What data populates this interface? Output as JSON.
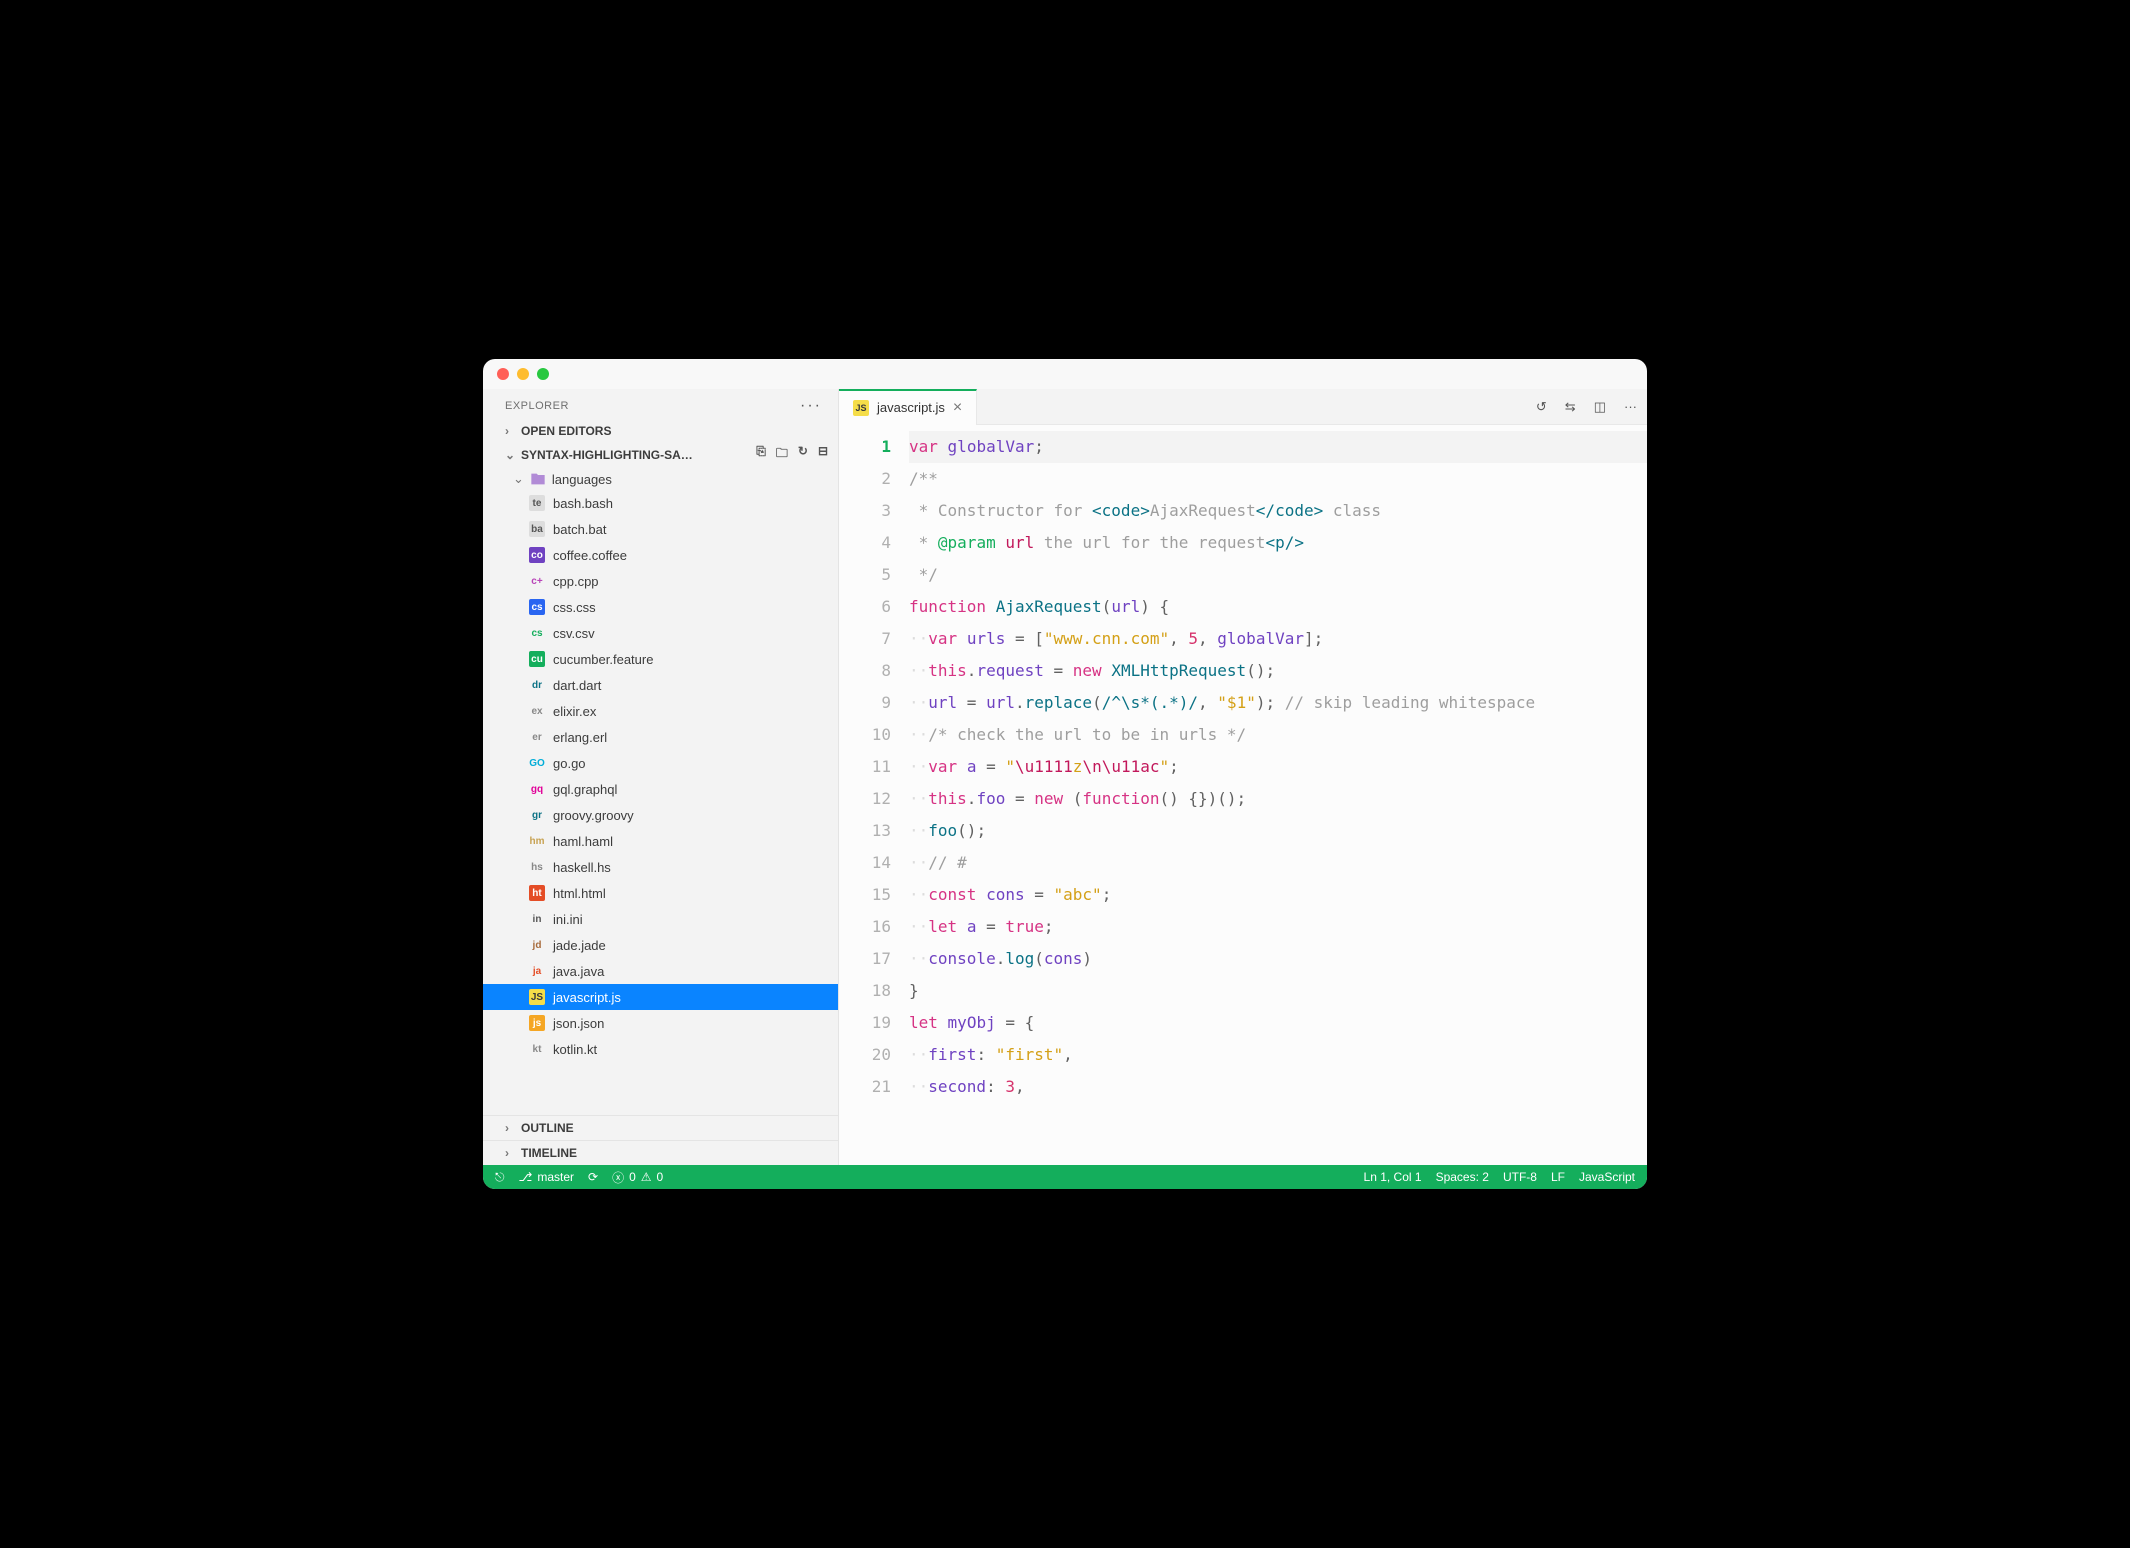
{
  "sidebar": {
    "title": "EXPLORER",
    "open_editors": "OPEN EDITORS",
    "project_name": "SYNTAX-HIGHLIGHTING-SA…",
    "folder": "languages",
    "files": [
      {
        "name": "bash.bash",
        "icon": "term",
        "color": "#555",
        "bg": "#ddd"
      },
      {
        "name": "batch.bat",
        "icon": "bat",
        "color": "#555",
        "bg": "#ddd"
      },
      {
        "name": "coffee.coffee",
        "icon": "cof",
        "color": "#fff",
        "bg": "#6f42c1"
      },
      {
        "name": "cpp.cpp",
        "icon": "c++",
        "color": "#b842b8",
        "bg": "transparent"
      },
      {
        "name": "css.css",
        "icon": "css",
        "color": "#fff",
        "bg": "#2965f1"
      },
      {
        "name": "csv.csv",
        "icon": "csv",
        "color": "#14ae5c",
        "bg": "transparent"
      },
      {
        "name": "cucumber.feature",
        "icon": "cuc",
        "color": "#fff",
        "bg": "#14ae5c"
      },
      {
        "name": "dart.dart",
        "icon": "drt",
        "color": "#0b7285",
        "bg": "transparent"
      },
      {
        "name": "elixir.ex",
        "icon": "ex",
        "color": "#888",
        "bg": "transparent"
      },
      {
        "name": "erlang.erl",
        "icon": "erl",
        "color": "#888",
        "bg": "transparent"
      },
      {
        "name": "go.go",
        "icon": "GO",
        "color": "#00add8",
        "bg": "transparent"
      },
      {
        "name": "gql.graphql",
        "icon": "gql",
        "color": "#e10098",
        "bg": "transparent"
      },
      {
        "name": "groovy.groovy",
        "icon": "grv",
        "color": "#0b7285",
        "bg": "transparent"
      },
      {
        "name": "haml.haml",
        "icon": "hml",
        "color": "#c7a252",
        "bg": "transparent"
      },
      {
        "name": "haskell.hs",
        "icon": "hs",
        "color": "#888",
        "bg": "transparent"
      },
      {
        "name": "html.html",
        "icon": "htm",
        "color": "#fff",
        "bg": "#e44d26"
      },
      {
        "name": "ini.ini",
        "icon": "ini",
        "color": "#555",
        "bg": "transparent"
      },
      {
        "name": "jade.jade",
        "icon": "jde",
        "color": "#a86b3c",
        "bg": "transparent"
      },
      {
        "name": "java.java",
        "icon": "jav",
        "color": "#e44d26",
        "bg": "transparent"
      },
      {
        "name": "javascript.js",
        "icon": "JS",
        "color": "#3a3a3a",
        "bg": "#f5dd49",
        "selected": true
      },
      {
        "name": "json.json",
        "icon": "jsn",
        "color": "#fff",
        "bg": "#f5a623"
      },
      {
        "name": "kotlin.kt",
        "icon": "kt",
        "color": "#888",
        "bg": "transparent"
      }
    ],
    "outline": "OUTLINE",
    "timeline": "TIMELINE"
  },
  "tab": {
    "label": "javascript.js"
  },
  "code": {
    "lines": 21,
    "tokens": [
      [
        [
          "kw",
          "var"
        ],
        [
          "punct",
          " "
        ],
        [
          "prop",
          "globalVar"
        ],
        [
          "punct",
          ";"
        ]
      ],
      [
        [
          "com",
          "/**"
        ]
      ],
      [
        [
          "ws",
          " "
        ],
        [
          "com",
          "* Constructor for "
        ],
        [
          "tag",
          "<code>"
        ],
        [
          "com",
          "AjaxRequest"
        ],
        [
          "tag",
          "</code>"
        ],
        [
          "com",
          " class"
        ]
      ],
      [
        [
          "ws",
          " "
        ],
        [
          "com",
          "* "
        ],
        [
          "dockw",
          "@param"
        ],
        [
          "com",
          " "
        ],
        [
          "docvar",
          "url"
        ],
        [
          "com",
          " the url for the request"
        ],
        [
          "tag",
          "<p/>"
        ]
      ],
      [
        [
          "ws",
          " "
        ],
        [
          "com",
          "*/"
        ]
      ],
      [
        [
          "kw",
          "function"
        ],
        [
          "punct",
          " "
        ],
        [
          "fn",
          "AjaxRequest"
        ],
        [
          "punct",
          "("
        ],
        [
          "prop",
          "url"
        ],
        [
          "punct",
          ") {"
        ]
      ],
      [
        [
          "ws",
          "··"
        ],
        [
          "kw",
          "var"
        ],
        [
          "punct",
          " "
        ],
        [
          "prop",
          "urls"
        ],
        [
          "punct",
          " = ["
        ],
        [
          "str",
          "\"www.cnn.com\""
        ],
        [
          "punct",
          ", "
        ],
        [
          "num",
          "5"
        ],
        [
          "punct",
          ", "
        ],
        [
          "prop",
          "globalVar"
        ],
        [
          "punct",
          "];"
        ]
      ],
      [
        [
          "ws",
          "··"
        ],
        [
          "kw",
          "this"
        ],
        [
          "punct",
          "."
        ],
        [
          "prop",
          "request"
        ],
        [
          "punct",
          " = "
        ],
        [
          "kw",
          "new"
        ],
        [
          "punct",
          " "
        ],
        [
          "fn",
          "XMLHttpRequest"
        ],
        [
          "punct",
          "();"
        ]
      ],
      [
        [
          "ws",
          "··"
        ],
        [
          "prop",
          "url"
        ],
        [
          "punct",
          " = "
        ],
        [
          "prop",
          "url"
        ],
        [
          "punct",
          "."
        ],
        [
          "fn",
          "replace"
        ],
        [
          "punct",
          "("
        ],
        [
          "reg",
          "/^\\s*(.*)/"
        ],
        [
          "punct",
          ", "
        ],
        [
          "str",
          "\"$1\""
        ],
        [
          "punct",
          "); "
        ],
        [
          "com",
          "// skip leading whitespace"
        ]
      ],
      [
        [
          "ws",
          "··"
        ],
        [
          "com",
          "/* check the url to be in urls */"
        ]
      ],
      [
        [
          "ws",
          "··"
        ],
        [
          "kw",
          "var"
        ],
        [
          "punct",
          " "
        ],
        [
          "prop",
          "a"
        ],
        [
          "punct",
          " = "
        ],
        [
          "str",
          "\""
        ],
        [
          "esc",
          "\\u1111"
        ],
        [
          "str",
          "z"
        ],
        [
          "esc",
          "\\n\\u11ac"
        ],
        [
          "str",
          "\""
        ],
        [
          "punct",
          ";"
        ]
      ],
      [
        [
          "ws",
          "··"
        ],
        [
          "kw",
          "this"
        ],
        [
          "punct",
          "."
        ],
        [
          "prop",
          "foo"
        ],
        [
          "punct",
          " = "
        ],
        [
          "kw",
          "new"
        ],
        [
          "punct",
          " ("
        ],
        [
          "kw",
          "function"
        ],
        [
          "punct",
          "() {})();"
        ]
      ],
      [
        [
          "ws",
          "··"
        ],
        [
          "fn",
          "foo"
        ],
        [
          "punct",
          "();"
        ]
      ],
      [
        [
          "ws",
          "··"
        ],
        [
          "com",
          "// #"
        ]
      ],
      [
        [
          "ws",
          "··"
        ],
        [
          "kw",
          "const"
        ],
        [
          "punct",
          " "
        ],
        [
          "prop",
          "cons"
        ],
        [
          "punct",
          " = "
        ],
        [
          "str",
          "\"abc\""
        ],
        [
          "punct",
          ";"
        ]
      ],
      [
        [
          "ws",
          "··"
        ],
        [
          "kw",
          "let"
        ],
        [
          "punct",
          " "
        ],
        [
          "prop",
          "a"
        ],
        [
          "punct",
          " = "
        ],
        [
          "kw",
          "true"
        ],
        [
          "punct",
          ";"
        ]
      ],
      [
        [
          "ws",
          "··"
        ],
        [
          "prop",
          "console"
        ],
        [
          "punct",
          "."
        ],
        [
          "fn",
          "log"
        ],
        [
          "punct",
          "("
        ],
        [
          "prop",
          "cons"
        ],
        [
          "punct",
          ")"
        ]
      ],
      [
        [
          "punct",
          "}"
        ]
      ],
      [
        [
          "kw",
          "let"
        ],
        [
          "punct",
          " "
        ],
        [
          "prop",
          "myObj"
        ],
        [
          "punct",
          " = {"
        ]
      ],
      [
        [
          "ws",
          "··"
        ],
        [
          "prop",
          "first"
        ],
        [
          "punct",
          ": "
        ],
        [
          "str",
          "\"first\""
        ],
        [
          "punct",
          ","
        ]
      ],
      [
        [
          "ws",
          "··"
        ],
        [
          "prop",
          "second"
        ],
        [
          "punct",
          ": "
        ],
        [
          "num",
          "3"
        ],
        [
          "punct",
          ","
        ]
      ]
    ]
  },
  "status": {
    "branch": "master",
    "errors": "0",
    "warnings": "0",
    "position": "Ln 1, Col 1",
    "spaces": "Spaces: 2",
    "encoding": "UTF-8",
    "eol": "LF",
    "language": "JavaScript"
  }
}
